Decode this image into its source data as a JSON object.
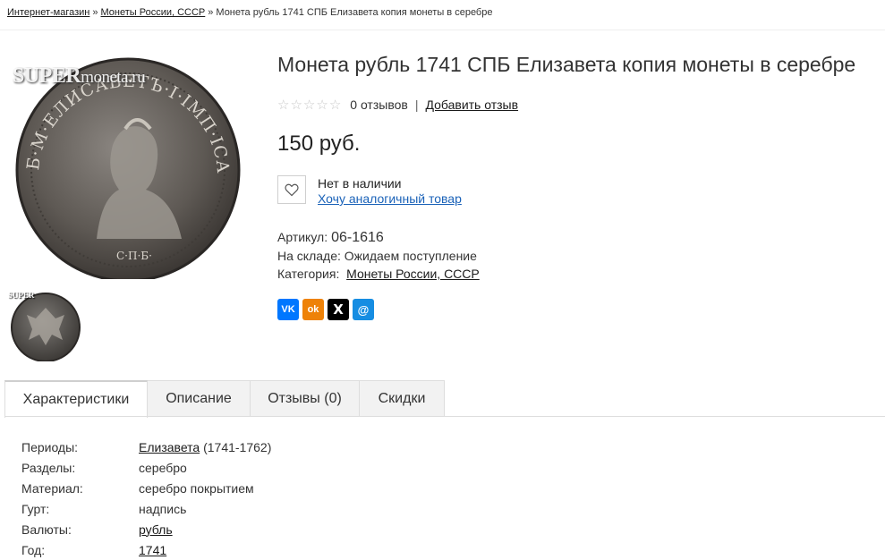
{
  "breadcrumb": {
    "items": [
      "Интернет-магазин",
      "Монеты России, СССР",
      "Монета рубль 1741 СПБ Елизавета копия монеты в серебре"
    ],
    "separator": "»"
  },
  "images": {
    "watermark_main": "SUPER",
    "watermark_main_suffix": "moneta.ru",
    "watermark_thumb": "SUPER",
    "coin_inscription": "Б·М·ЕЛИСАВЕТЪ·I·IМП·IСАМОД·ВСЕРОС",
    "coin_mint": "С·П·Б·"
  },
  "product": {
    "title": "Монета рубль 1741 СПБ Елизавета копия монеты в серебре",
    "reviews_count": "0 отзывов",
    "rating_separator": "|",
    "add_review": "Добавить отзыв",
    "rating_value": 0,
    "rating_max": 5,
    "price": "150 руб.",
    "availability": "Нет в наличии",
    "want_similar": "Хочу аналогичный товар",
    "sku_label": "Артикул:",
    "sku_value": "06-1616",
    "stock_label": "На складе:",
    "stock_value": "Ожидаем поступление",
    "category_label": "Категория:",
    "category_value": "Монеты России, СССР"
  },
  "social": [
    {
      "name": "vk",
      "label": "VK",
      "color": "#0077ff"
    },
    {
      "name": "ok",
      "label": "ok",
      "color": "#ee8208"
    },
    {
      "name": "x",
      "label": "X",
      "color": "#000000"
    },
    {
      "name": "mailru",
      "label": "@",
      "color": "#168de2"
    }
  ],
  "tabs": [
    {
      "label": "Характеристики",
      "active": true
    },
    {
      "label": "Описание",
      "active": false
    },
    {
      "label": "Отзывы (0)",
      "active": false
    },
    {
      "label": "Скидки",
      "active": false
    }
  ],
  "specs": [
    {
      "label": "Периоды:",
      "value": "Елизавета",
      "extra": "(1741-1762)",
      "link": true
    },
    {
      "label": "Разделы:",
      "value": "серебро",
      "extra": "",
      "link": false
    },
    {
      "label": "Материал:",
      "value": "серебро покрытием",
      "extra": "",
      "link": false
    },
    {
      "label": "Гурт:",
      "value": "надпись",
      "extra": "",
      "link": false
    },
    {
      "label": "Валюты:",
      "value": "рубль",
      "extra": "",
      "link": true
    },
    {
      "label": "Год:",
      "value": "1741",
      "extra": "",
      "link": true
    }
  ],
  "colors": {
    "link_blue": "#1a62b8",
    "star_empty": "#c8c8c8",
    "tab_bg": "#f2f2f2"
  }
}
